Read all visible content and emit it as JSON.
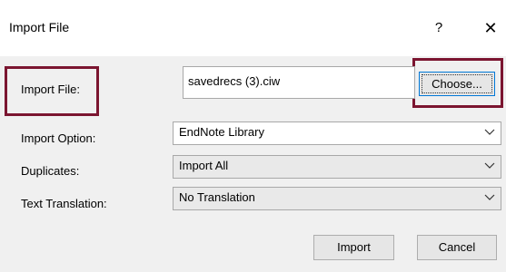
{
  "dialog": {
    "title": "Import File",
    "help_label": "?",
    "close_label": "✕"
  },
  "fields": {
    "import_file": {
      "label": "Import File:",
      "value": "savedrecs (3).ciw",
      "choose_label": "Choose..."
    },
    "import_option": {
      "label": "Import Option:",
      "value": "EndNote Library"
    },
    "duplicates": {
      "label": "Duplicates:",
      "value": "Import All"
    },
    "text_translation": {
      "label": "Text Translation:",
      "value": "No Translation"
    }
  },
  "buttons": {
    "import_label": "Import",
    "cancel_label": "Cancel"
  },
  "colors": {
    "highlight": "#7b1530",
    "focus": "#0078d7",
    "dialog_bg": "#f0f0f0"
  }
}
